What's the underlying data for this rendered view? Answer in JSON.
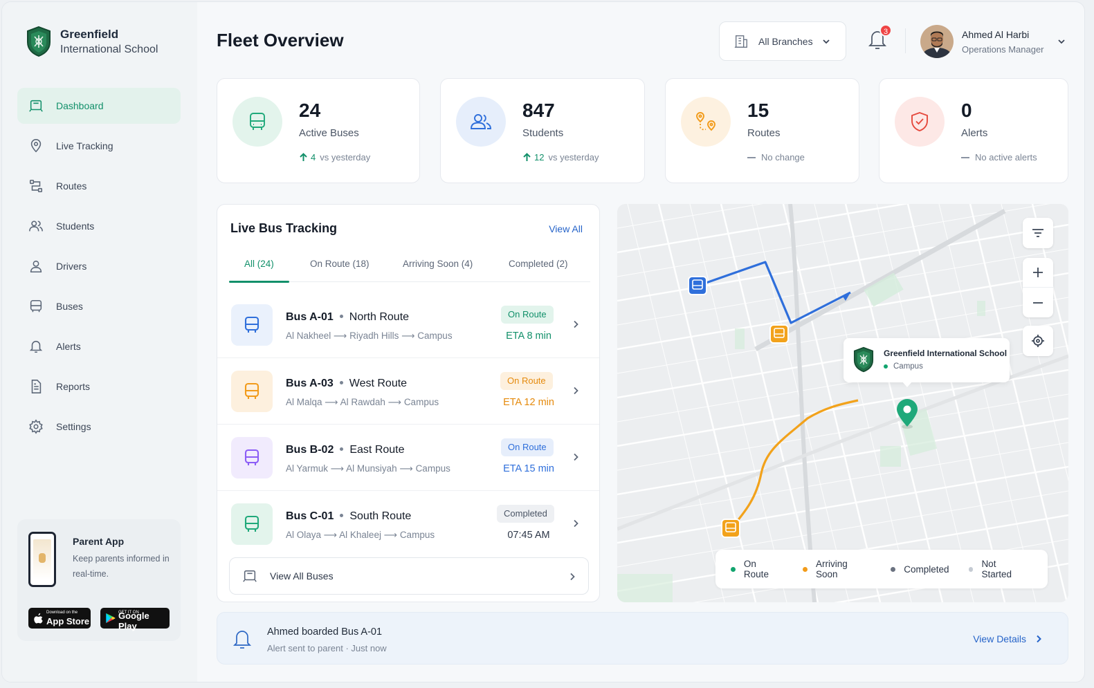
{
  "brand": {
    "name": "Greenfield",
    "subtitle": "International School"
  },
  "nav": [
    {
      "label": "Dashboard",
      "icon": "dashboard-icon",
      "active": true
    },
    {
      "label": "Live Tracking",
      "icon": "location-pin-icon"
    },
    {
      "label": "Routes",
      "icon": "routes-icon"
    },
    {
      "label": "Students",
      "icon": "users-icon"
    },
    {
      "label": "Drivers",
      "icon": "driver-icon"
    },
    {
      "label": "Buses",
      "icon": "bus-icon"
    },
    {
      "label": "Alerts",
      "icon": "bell-icon"
    },
    {
      "label": "Reports",
      "icon": "report-icon"
    },
    {
      "label": "Settings",
      "icon": "gear-icon"
    }
  ],
  "promo": {
    "title": "Parent App",
    "description": "Keep parents informed in real-time.",
    "apple_small": "Download on the",
    "apple_label": "App Store",
    "google_small": "GET IT ON",
    "google_label": "Google Play"
  },
  "header": {
    "title": "Fleet Overview",
    "branch_selector": "All Branches",
    "notification_count": "3",
    "user_name": "Ahmed Al Harbi",
    "user_role": "Operations Manager"
  },
  "stats": [
    {
      "value": "24",
      "label": "Active Buses",
      "delta_value": "4",
      "delta_text": "vs yesterday",
      "trend": "up"
    },
    {
      "value": "847",
      "label": "Students",
      "delta_value": "12",
      "delta_text": "vs yesterday",
      "trend": "up"
    },
    {
      "value": "15",
      "label": "Routes",
      "delta_text": "No change",
      "trend": "flat"
    },
    {
      "value": "0",
      "label": "Alerts",
      "delta_text": "No active alerts",
      "trend": "flat"
    }
  ],
  "tracking": {
    "title": "Live Bus Tracking",
    "view_all": "View All",
    "tabs": [
      "All (24)",
      "On Route (18)",
      "Arriving Soon (4)",
      "Completed (2)"
    ],
    "active_tab": 0,
    "buses": [
      {
        "id": "Bus A-01",
        "route": "North Route",
        "stops": [
          "Al Nakheel",
          "Riyadh Hills",
          "Campus"
        ],
        "status": "On Route",
        "eta": "ETA 8 min",
        "color": "#2f6fdb"
      },
      {
        "id": "Bus A-03",
        "route": "West Route",
        "stops": [
          "Al Malqa",
          "Al Rawdah",
          "Campus"
        ],
        "status": "On Route",
        "eta": "ETA 12 min",
        "color": "#f29b1a"
      },
      {
        "id": "Bus B-02",
        "route": "East Route",
        "stops": [
          "Al Yarmuk",
          "Al Munsiyah",
          "Campus"
        ],
        "status": "On Route",
        "eta": "ETA 15 min",
        "color": "#8b5cf6"
      },
      {
        "id": "Bus C-01",
        "route": "South Route",
        "stops": [
          "Al Olaya",
          "Al Khaleej",
          "Campus"
        ],
        "status": "Completed",
        "eta": "07:45 AM",
        "color": "#1fa97a"
      }
    ],
    "view_all_buses": "View All Buses"
  },
  "map": {
    "callout_title": "Greenfield International School",
    "callout_sub": "Campus",
    "legend": [
      {
        "label": "On Route",
        "color": "#12a46e"
      },
      {
        "label": "Arriving Soon",
        "color": "#f29b1a"
      },
      {
        "label": "Completed",
        "color": "#6b7280"
      },
      {
        "label": "Not Started",
        "color": "#c5cbd3"
      }
    ]
  },
  "alert": {
    "title": "Ahmed boarded Bus A-01",
    "subtitle": "Alert sent to parent  ·  Just now",
    "action": "View Details"
  }
}
